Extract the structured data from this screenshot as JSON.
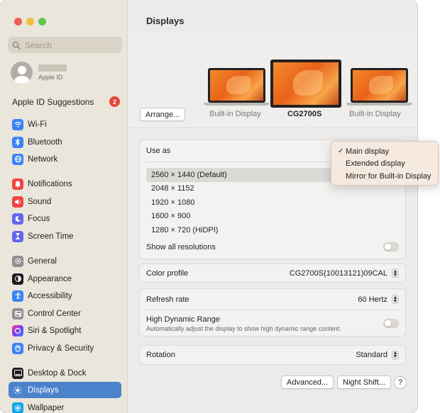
{
  "window": {
    "traffic_lights": [
      "close",
      "minimize",
      "zoom"
    ]
  },
  "sidebar": {
    "search_placeholder": "Search",
    "apple_id_label": "Apple ID",
    "suggestions": {
      "label": "Apple ID Suggestions",
      "badge": "2"
    },
    "items": [
      {
        "label": "Wi-Fi",
        "icon": "wifi-icon",
        "color": "#3b82f6"
      },
      {
        "label": "Bluetooth",
        "icon": "bluetooth-icon",
        "color": "#3b82f6"
      },
      {
        "label": "Network",
        "icon": "globe-icon",
        "color": "#3b82f6"
      },
      {
        "label": "Notifications",
        "icon": "bell-icon",
        "color": "#ef4444"
      },
      {
        "label": "Sound",
        "icon": "speaker-icon",
        "color": "#ef4444"
      },
      {
        "label": "Focus",
        "icon": "moon-icon",
        "color": "#6366f1"
      },
      {
        "label": "Screen Time",
        "icon": "hourglass-icon",
        "color": "#6366f1"
      },
      {
        "label": "General",
        "icon": "gear-icon",
        "color": "#8e8e93"
      },
      {
        "label": "Appearance",
        "icon": "appearance-icon",
        "color": "#1c1c1e"
      },
      {
        "label": "Accessibility",
        "icon": "accessibility-icon",
        "color": "#3b82f6"
      },
      {
        "label": "Control Center",
        "icon": "control-center-icon",
        "color": "#8e8e93"
      },
      {
        "label": "Siri & Spotlight",
        "icon": "siri-icon",
        "color": "#7c3aed"
      },
      {
        "label": "Privacy & Security",
        "icon": "hand-icon",
        "color": "#3b82f6"
      },
      {
        "label": "Desktop & Dock",
        "icon": "dock-icon",
        "color": "#1c1c1e"
      },
      {
        "label": "Displays",
        "icon": "sun-icon",
        "color": "#3b82f6"
      },
      {
        "label": "Wallpaper",
        "icon": "wallpaper-icon",
        "color": "#0ea5e9"
      }
    ],
    "active_item": "Displays"
  },
  "main": {
    "title": "Displays",
    "arrange_button": "Arrange...",
    "monitors": [
      {
        "label": "Built-in Display"
      },
      {
        "label": "CG2700S"
      },
      {
        "label": "Built-in Display"
      }
    ],
    "use_as": {
      "label": "Use as",
      "menu_items": [
        "Main display",
        "Extended display",
        "Mirror for Built-in Display"
      ],
      "selected": "Main display"
    },
    "resolutions": [
      "2560 × 1440 (Default)",
      "2048 × 1152",
      "1920 × 1080",
      "1600 × 900",
      "1280 × 720 (HiDPI)"
    ],
    "selected_resolution": "2560 × 1440 (Default)",
    "show_all_resolutions": {
      "label": "Show all resolutions",
      "on": false
    },
    "color_profile": {
      "label": "Color profile",
      "value": "CG2700S(10013121)09CAL"
    },
    "refresh_rate": {
      "label": "Refresh rate",
      "value": "60 Hertz"
    },
    "hdr": {
      "label": "High Dynamic Range",
      "description": "Automatically adjust the display to show high dynamic range content.",
      "on": false
    },
    "rotation": {
      "label": "Rotation",
      "value": "Standard"
    },
    "footer": {
      "advanced": "Advanced...",
      "night_shift": "Night Shift...",
      "help": "?"
    }
  },
  "colors": {
    "accent": "#4a82cc",
    "sidebar_bg": "#ebe6dc"
  }
}
